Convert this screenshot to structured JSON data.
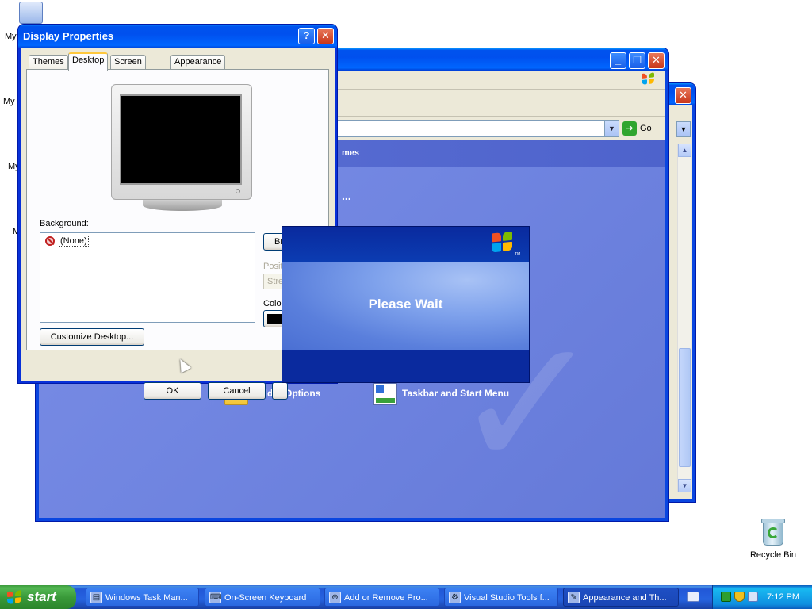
{
  "desktop": {
    "icons": [
      {
        "label": "My",
        "icon": "my-documents-icon"
      },
      {
        "label": "My I",
        "icon": "my-computer-icon"
      },
      {
        "label": "My",
        "icon": "my-network-icon"
      },
      {
        "label": "M",
        "icon": "media-icon"
      }
    ],
    "recycle_bin": {
      "label": "Recycle Bin",
      "icon": "recycle-bin-icon"
    }
  },
  "background_window": {
    "address_go": "Go",
    "section_title_partial": "mes",
    "ellipsis": "...",
    "items": [
      {
        "label": "Folder Options",
        "icon": "folder-options-icon"
      },
      {
        "label": "Taskbar and Start Menu",
        "icon": "taskbar-icon"
      }
    ]
  },
  "dialog": {
    "title": "Display Properties",
    "help_label": "?",
    "close_label": "✕",
    "tabs": [
      "Themes",
      "Desktop",
      "Screen Saver",
      "Appearance"
    ],
    "active_tab": "Desktop",
    "background_label": "Background:",
    "background_items": [
      "(None)"
    ],
    "browse_label": "Br",
    "position_label": "Positi",
    "position_value": "Stret",
    "color_label": "Color:",
    "color_value": "#000000",
    "customize_label": "Customize Desktop...",
    "ok_label": "OK",
    "cancel_label": "Cancel"
  },
  "splash": {
    "message": "Please Wait",
    "tm": "TM"
  },
  "taskbar": {
    "start_label": "start",
    "tasks": [
      {
        "label": "Windows Task Man...",
        "icon": "task-manager-icon",
        "active": false
      },
      {
        "label": "On-Screen Keyboard",
        "icon": "keyboard-icon",
        "active": false
      },
      {
        "label": "Add or Remove Pro...",
        "icon": "add-remove-icon",
        "active": false
      },
      {
        "label": "Visual Studio Tools f...",
        "icon": "visual-studio-icon",
        "active": false
      },
      {
        "label": "Appearance and Th...",
        "icon": "appearance-icon",
        "active": true
      }
    ],
    "clock": "7:12 PM"
  }
}
